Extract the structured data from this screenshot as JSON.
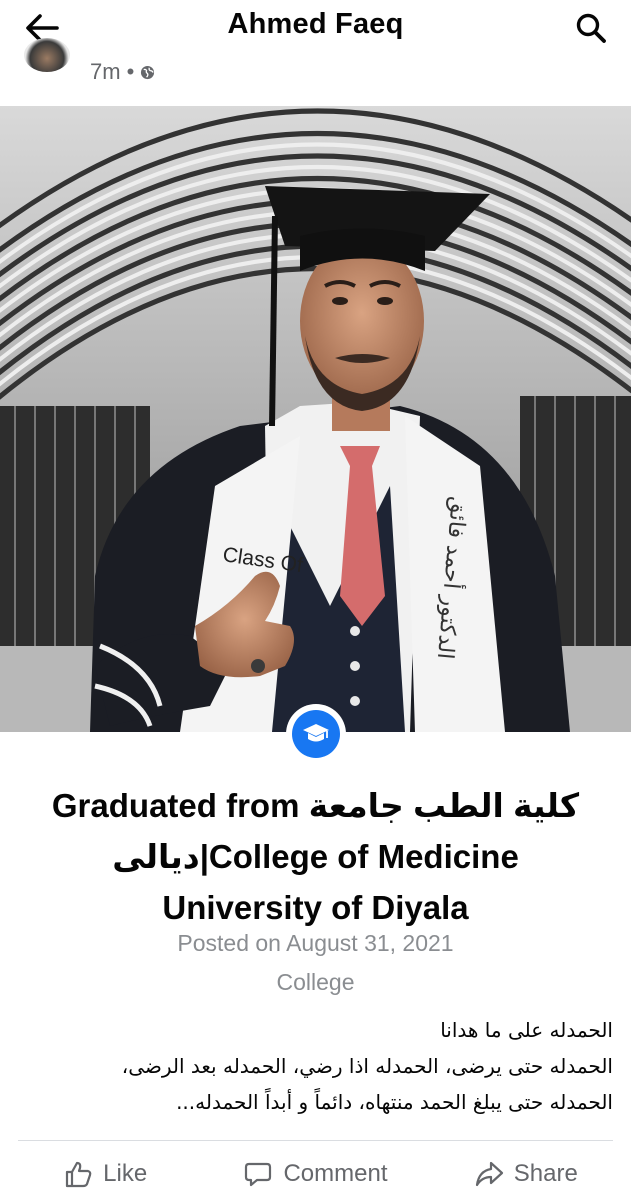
{
  "header": {
    "title": "Ahmed Faeq",
    "back_icon": "arrow-left-icon",
    "search_icon": "search-icon"
  },
  "post_meta": {
    "time": "7m",
    "separator": "•",
    "privacy_icon": "globe-icon"
  },
  "photo": {
    "sash_text_left": "Class Of",
    "sash_text_right": "الدكتور أحمد فائق"
  },
  "life_event": {
    "icon": "graduation-cap-icon",
    "headline": "Graduated from كلية الطب جامعة ديالى|College of Medicine University of Diyala",
    "posted": "Posted on August 31, 2021",
    "category": "College"
  },
  "caption": {
    "line1": "الحمدله على ما هدانا",
    "line2": "الحمدله حتى يرضى، الحمدله اذا رضي، الحمدله بعد الرضى،",
    "line3": "الحمدله حتى يبلغ الحمد منتهاه، دائماً و أبداً الحمدله..."
  },
  "actions": {
    "like": "Like",
    "comment": "Comment",
    "share": "Share"
  },
  "colors": {
    "accent": "#1877f2",
    "secondary_text": "#65676b",
    "muted_text": "#8a8d91"
  }
}
